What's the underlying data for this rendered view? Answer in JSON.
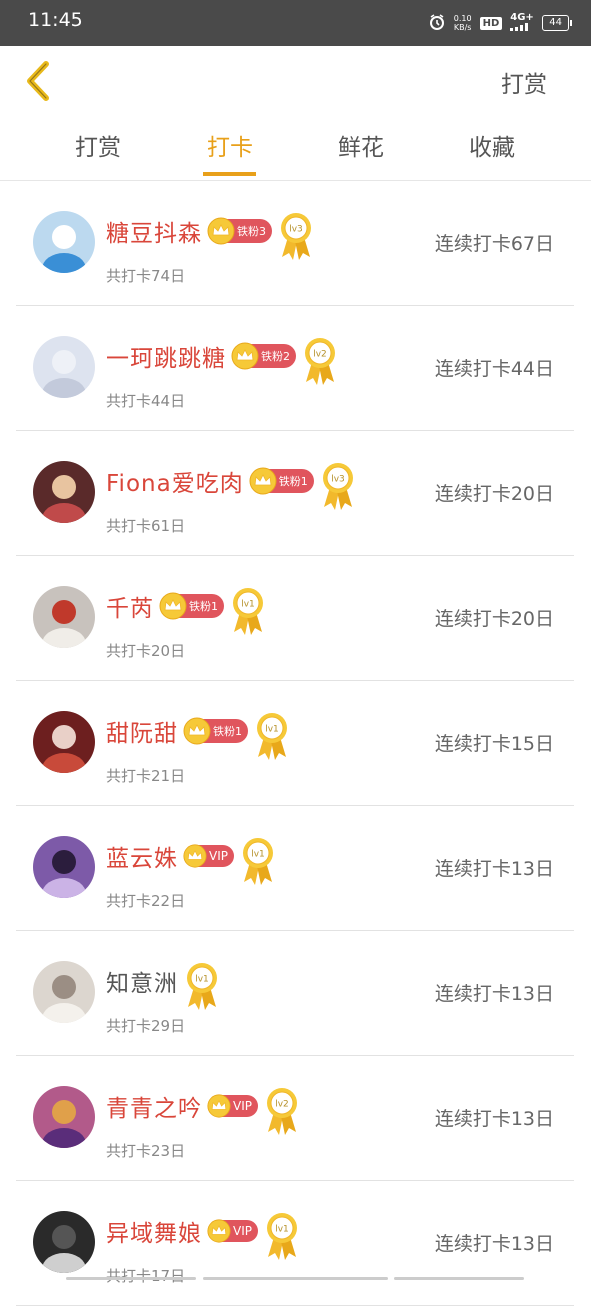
{
  "status_bar": {
    "time": "11:45",
    "net_speed": "0.10",
    "net_unit": "KB/s",
    "hd": "HD",
    "signal": "4G+",
    "battery": "44"
  },
  "header": {
    "title": "打赏"
  },
  "tabs": [
    {
      "label": "打赏",
      "active": false
    },
    {
      "label": "打卡",
      "active": true
    },
    {
      "label": "鲜花",
      "active": false
    },
    {
      "label": "收藏",
      "active": false
    }
  ],
  "rows": [
    {
      "name": "糖豆抖森",
      "badge": "铁粉3",
      "level": "lv3",
      "total": "共打卡74日",
      "streak": "连续打卡67日"
    },
    {
      "name": "一珂跳跳糖",
      "badge": "铁粉2",
      "level": "lv2",
      "total": "共打卡44日",
      "streak": "连续打卡44日"
    },
    {
      "name": "Fiona爱吃肉",
      "badge": "铁粉1",
      "level": "lv3",
      "total": "共打卡61日",
      "streak": "连续打卡20日"
    },
    {
      "name": "千芮",
      "badge": "铁粉1",
      "level": "lv1",
      "total": "共打卡20日",
      "streak": "连续打卡20日"
    },
    {
      "name": "甜阮甜",
      "badge": "铁粉1",
      "level": "lv1",
      "total": "共打卡21日",
      "streak": "连续打卡15日"
    },
    {
      "name": "蓝云姝",
      "badge": "VIP",
      "level": "lv1",
      "total": "共打卡22日",
      "streak": "连续打卡13日"
    },
    {
      "name": "知意洲",
      "badge": "",
      "level": "lv1",
      "total": "共打卡29日",
      "streak": "连续打卡13日"
    },
    {
      "name": "青青之吟",
      "badge": "VIP",
      "level": "lv2",
      "total": "共打卡23日",
      "streak": "连续打卡13日"
    },
    {
      "name": "异域舞娘",
      "badge": "VIP",
      "level": "lv1",
      "total": "共打卡17日",
      "streak": "连续打卡13日"
    }
  ],
  "colors": {
    "accent": "#e8a01a",
    "name_red": "#d9463a",
    "badge_red": "#e0555d"
  }
}
